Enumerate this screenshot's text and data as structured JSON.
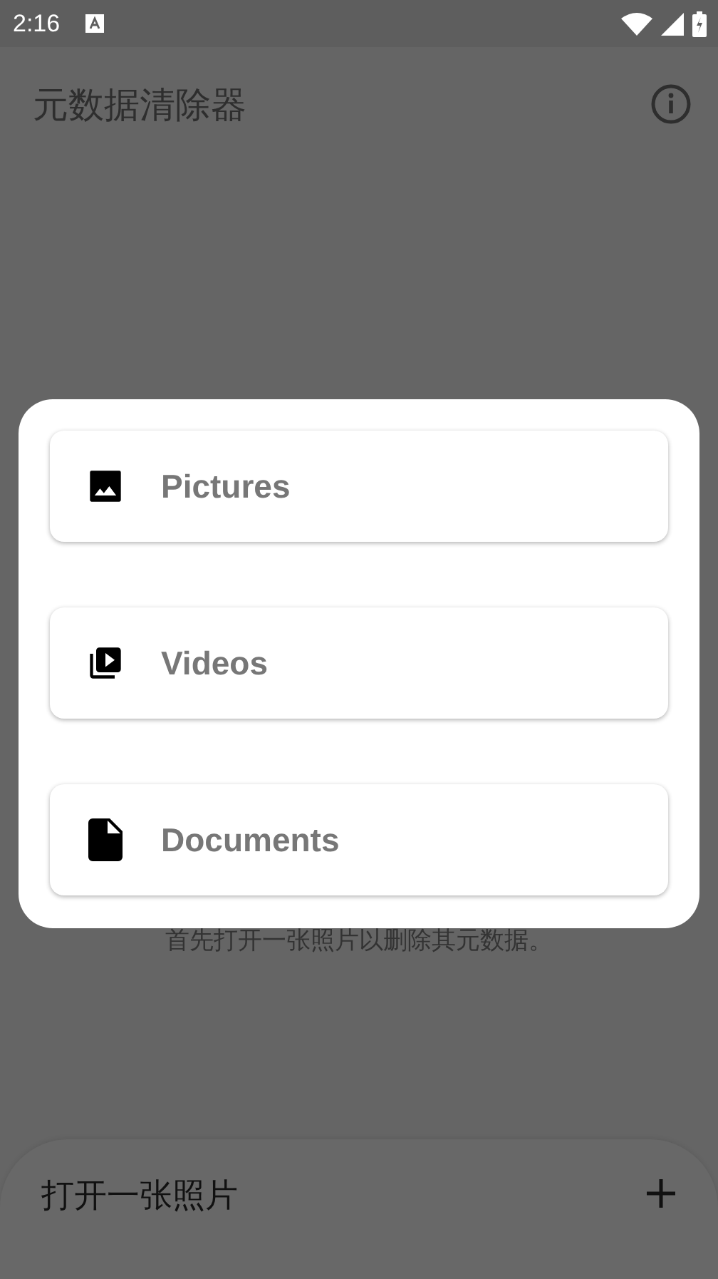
{
  "status_bar": {
    "time": "2:16"
  },
  "app_bar": {
    "title": "元数据清除器"
  },
  "hint": "首先打开一张照片以删除其元数据。",
  "dialog": {
    "options": [
      {
        "kind": "image",
        "label": "Pictures"
      },
      {
        "kind": "video",
        "label": "Videos"
      },
      {
        "kind": "document",
        "label": "Documents"
      }
    ]
  },
  "bottom_bar": {
    "label": "打开一张照片"
  }
}
